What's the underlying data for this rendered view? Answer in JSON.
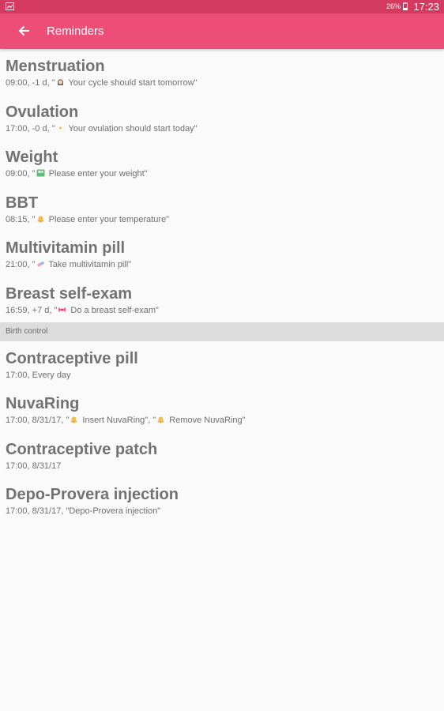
{
  "status_bar": {
    "battery": "26%",
    "time": "17:23"
  },
  "app_bar": {
    "title": "Reminders"
  },
  "colors": {
    "status_bar": "#d43a5f",
    "app_bar": "#ec4e78",
    "section_header_bg": "#dcdcdc",
    "background": "#fafafa"
  },
  "reminders": [
    {
      "name": "Menstruation",
      "detail_prefix": "09:00, -1 d, \"",
      "icon": "woman-icon",
      "detail_suffix": " Your cycle should start tomorrow\""
    },
    {
      "name": "Ovulation",
      "detail_prefix": "17:00, -0 d, \"",
      "icon": "daisy-icon",
      "detail_suffix": " Your ovulation should start today\""
    },
    {
      "name": "Weight",
      "detail_prefix": "09:00, \"",
      "icon": "scale-icon",
      "detail_suffix": " Please enter your weight\""
    },
    {
      "name": "BBT",
      "detail_prefix": "08:15, \"",
      "icon": "bell-icon",
      "detail_suffix": " Please enter your temperature\""
    },
    {
      "name": "Multivitamin pill",
      "detail_prefix": "21:00, \"",
      "icon": "pill-icon",
      "detail_suffix": " Take multivitamin pill\""
    },
    {
      "name": "Breast self-exam",
      "detail_prefix": "16:59, +7 d, \"",
      "icon": "ribbon-icon",
      "detail_suffix": " Do a breast self-exam\""
    }
  ],
  "birth_control": {
    "header": "Birth control",
    "items": [
      {
        "name": "Contraceptive pill",
        "detail": "17:00, Every day"
      },
      {
        "name": "NuvaRing",
        "detail_prefix": "17:00, 8/31/17, \"",
        "icon_1": "bell-icon",
        "detail_middle": " Insert NuvaRing\", \"",
        "icon_2": "bell-icon",
        "detail_suffix": " Remove NuvaRing\""
      },
      {
        "name": "Contraceptive patch",
        "detail": "17:00, 8/31/17"
      },
      {
        "name": "Depo-Provera injection",
        "detail": "17:00, 8/31/17, \"Depo-Provera injection\""
      }
    ]
  }
}
